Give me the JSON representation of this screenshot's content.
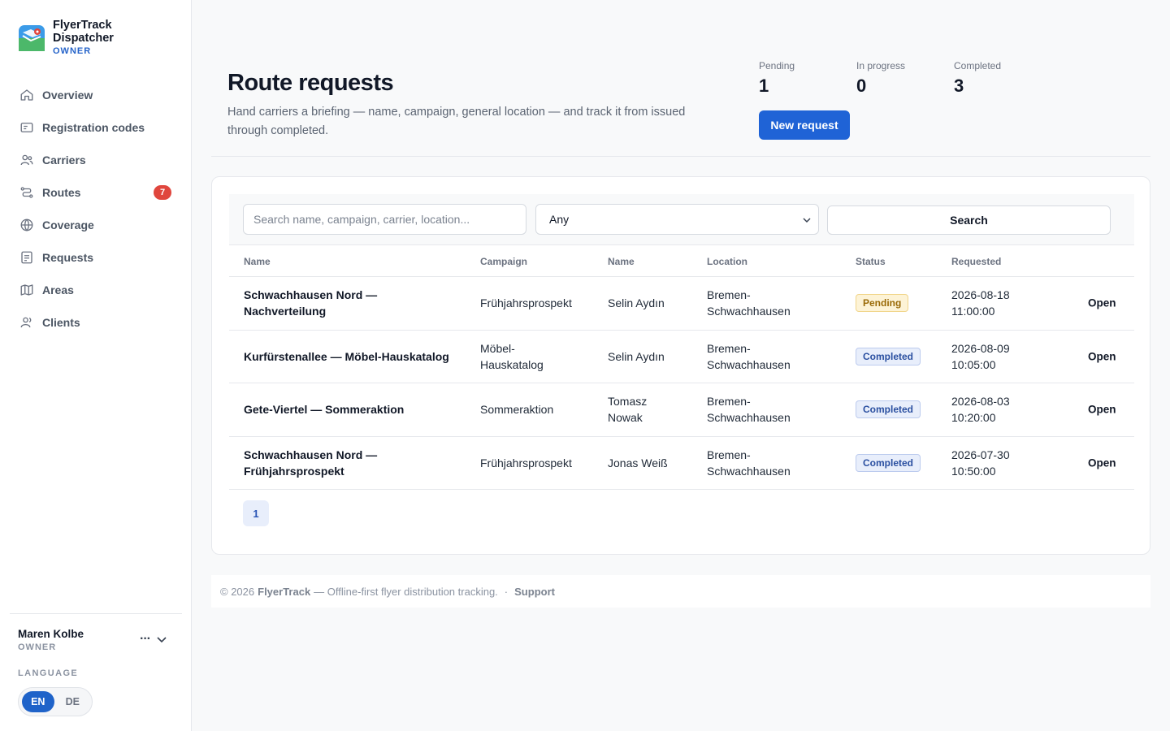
{
  "brand": {
    "name": "FlyerTrack Dispatcher",
    "role": "OWNER"
  },
  "nav": [
    {
      "label": "Overview",
      "icon": "home-icon"
    },
    {
      "label": "Registration codes",
      "icon": "id-card-icon"
    },
    {
      "label": "Carriers",
      "icon": "users-icon"
    },
    {
      "label": "Routes",
      "icon": "route-icon",
      "badge": "7"
    },
    {
      "label": "Coverage",
      "icon": "globe-icon"
    },
    {
      "label": "Requests",
      "icon": "document-icon"
    },
    {
      "label": "Areas",
      "icon": "map-icon"
    },
    {
      "label": "Clients",
      "icon": "user-group-icon"
    }
  ],
  "user": {
    "name": "Maren Kolbe",
    "role": "OWNER",
    "menu": "···"
  },
  "language": {
    "label": "LANGUAGE",
    "options": [
      "EN",
      "DE"
    ],
    "selected": "EN"
  },
  "header": {
    "title": "Route requests",
    "description": "Hand carriers a briefing — name, campaign, general location — and track it from issued through completed.",
    "new_button": "New request"
  },
  "stats": [
    {
      "label": "Pending",
      "value": "1"
    },
    {
      "label": "In progress",
      "value": "0"
    },
    {
      "label": "Completed",
      "value": "3"
    }
  ],
  "filters": {
    "search_placeholder": "Search name, campaign, carrier, location...",
    "status_selected": "Any",
    "search_button": "Search"
  },
  "table": {
    "columns": [
      "Name",
      "Campaign",
      "Name",
      "Location",
      "Status",
      "Requested"
    ],
    "rows": [
      {
        "name": "Schwachhausen Nord — Nachverteilung",
        "campaign": "Frühjahrsprospekt",
        "carrier": "Selin Aydın",
        "location": "Bremen-Schwachhausen",
        "status": "Pending",
        "status_kind": "pending",
        "requested": "2026-08-18 11:00:00",
        "action": "Open"
      },
      {
        "name": "Kurfürstenallee — Möbel-Hauskatalog",
        "campaign": "Möbel-Hauskatalog",
        "carrier": "Selin Aydın",
        "location": "Bremen-Schwachhausen",
        "status": "Completed",
        "status_kind": "completed",
        "requested": "2026-08-09 10:05:00",
        "action": "Open"
      },
      {
        "name": "Gete-Viertel — Sommeraktion",
        "campaign": "Sommeraktion",
        "carrier": "Tomasz Nowak",
        "location": "Bremen-Schwachhausen",
        "status": "Completed",
        "status_kind": "completed",
        "requested": "2026-08-03 10:20:00",
        "action": "Open"
      },
      {
        "name": "Schwachhausen Nord — Frühjahrsprospekt",
        "campaign": "Frühjahrsprospekt",
        "carrier": "Jonas Weiß",
        "location": "Bremen-Schwachhausen",
        "status": "Completed",
        "status_kind": "completed",
        "requested": "2026-07-30 10:50:00",
        "action": "Open"
      }
    ]
  },
  "pagination": {
    "current": "1"
  },
  "footer": {
    "copyright": "© 2026",
    "brand": "FlyerTrack",
    "tagline": "— Offline-first flyer distribution tracking.",
    "separator": "·",
    "support": "Support"
  },
  "colors": {
    "accent": "#1f63d6",
    "badge_red": "#e0463d",
    "pending": "#9a6a07",
    "completed": "#2a4fa0"
  }
}
